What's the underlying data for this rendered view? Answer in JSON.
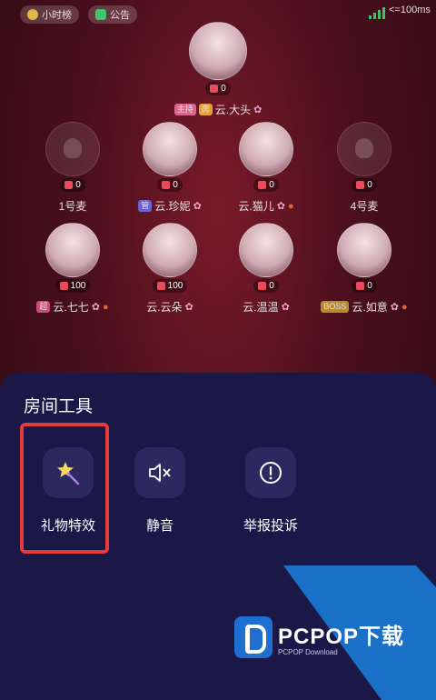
{
  "topbar": {
    "rank_label": "小时榜",
    "notice_label": "公告",
    "network_note": "<=100ms"
  },
  "host": {
    "gift_count": "0",
    "role_badge": "主持",
    "tag_badge": "房",
    "name": "云.大头"
  },
  "seats_row1": [
    {
      "count": "0",
      "name": "1号麦",
      "empty": true
    },
    {
      "count": "0",
      "name": "云.珍妮",
      "badge": "管"
    },
    {
      "count": "0",
      "name": "云.猫儿"
    },
    {
      "count": "0",
      "name": "4号麦",
      "empty": true
    }
  ],
  "seats_row2": [
    {
      "count": "100",
      "name": "云.七七",
      "badge": "超"
    },
    {
      "count": "100",
      "name": "云.云朵"
    },
    {
      "count": "0",
      "name": "云.温温"
    },
    {
      "count": "0",
      "name": "云.如意",
      "badge": "BOSS"
    }
  ],
  "sheet": {
    "title": "房间工具",
    "tools": [
      {
        "label": "礼物特效",
        "icon": "magic-wand-star-icon"
      },
      {
        "label": "静音",
        "icon": "speaker-mute-icon"
      },
      {
        "label": "举报投诉",
        "icon": "alert-circle-icon"
      }
    ]
  },
  "watermark": {
    "brand": "PCPOP下载",
    "sub": "PCPOP Download"
  },
  "colors": {
    "sheet_bg": "#1b1747",
    "tool_bg": "#2c2860",
    "highlight": "#e53b3b",
    "room_bg": "#4a0f1c"
  }
}
